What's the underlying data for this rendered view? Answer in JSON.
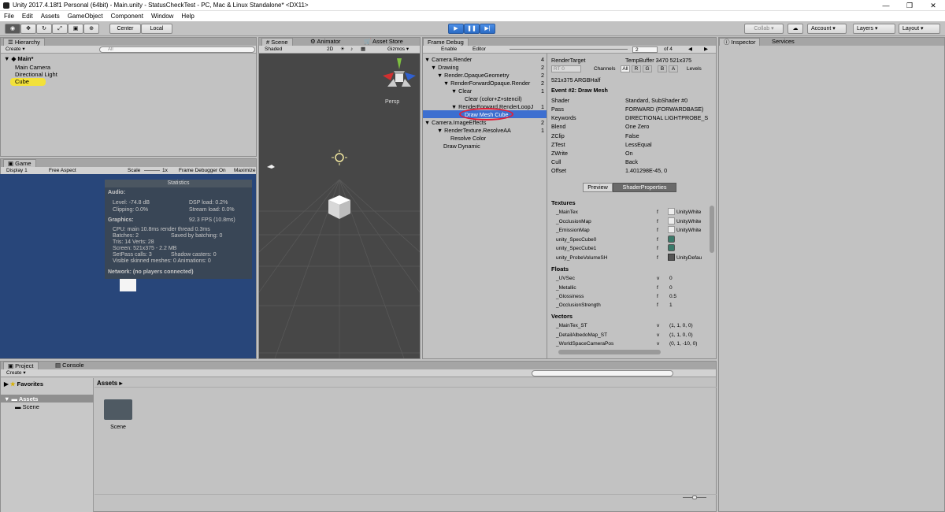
{
  "window": {
    "title": "Unity 2017.4.18f1 Personal (64bit) - Main.unity - StatusCheckTest - PC, Mac & Linux Standalone* <DX11>",
    "minimize": "—",
    "maximize": "❐",
    "close": "✕"
  },
  "menu": [
    "File",
    "Edit",
    "Assets",
    "GameObject",
    "Component",
    "Window",
    "Help"
  ],
  "toolbar": {
    "center": "Center",
    "local": "Local",
    "collab": "Collab ▾",
    "account": "Account",
    "layers": "Layers",
    "layout": "Layout"
  },
  "hierarchy": {
    "tab": "Hierarchy",
    "create": "Create ▾",
    "search_placeholder": "All",
    "scene": "Main*",
    "items": [
      "Main Camera",
      "Directional Light",
      "Cube"
    ]
  },
  "game": {
    "tab": "Game",
    "display": "Display 1",
    "aspect": "Free Aspect",
    "scale_label": "Scale",
    "scale_value": "1x",
    "frame_debugger": "Frame Debugger On",
    "maximize": "Maximize",
    "stats": {
      "title": "Statistics",
      "audio_label": "Audio:",
      "level": "Level: -74.8 dB",
      "dsp": "DSP load: 0.2%",
      "clipping": "Clipping: 0.0%",
      "stream": "Stream load: 0.0%",
      "graphics_label": "Graphics:",
      "fps": "92.3 FPS (10.8ms)",
      "cpu": "CPU: main 10.8ms  render thread 0.3ms",
      "batches": "Batches: 2",
      "saved": "Saved by batching: 0",
      "tris": "Tris: 14   Verts: 28",
      "screen": "Screen: 521x375 - 2.2 MB",
      "setpass": "SetPass calls: 3",
      "shadow": "Shadow casters: 0",
      "skinned": "Visible skinned meshes: 0  Animations: 0",
      "network": "Network: (no players connected)"
    }
  },
  "scene": {
    "tabs": [
      "Scene",
      "Animator",
      "Asset Store"
    ],
    "shaded": "Shaded",
    "mode2d": "2D",
    "gizmos": "Gizmos ▾",
    "persp": "Persp"
  },
  "frame_debug": {
    "tab": "Frame Debug",
    "enable": "Enable",
    "editor": "Editor",
    "event_index": "2",
    "event_total": "of 4",
    "tree": [
      {
        "label": "Camera.Render",
        "count": "4"
      },
      {
        "label": "Drawing",
        "count": "2"
      },
      {
        "label": "Render.OpaqueGeometry",
        "count": "2"
      },
      {
        "label": "RenderForwardOpaque.Render",
        "count": "2"
      },
      {
        "label": "Clear",
        "count": "1"
      },
      {
        "label": "Clear (color+Z+stencil)",
        "count": ""
      },
      {
        "label": "RenderForward.RenderLoopJ",
        "count": "1"
      },
      {
        "label": "Draw Mesh Cube",
        "count": ""
      },
      {
        "label": "Camera.ImageEffects",
        "count": "2"
      },
      {
        "label": "RenderTexture.ResolveAA",
        "count": "1"
      },
      {
        "label": "Resolve Color",
        "count": ""
      },
      {
        "label": "Draw Dynamic",
        "count": ""
      }
    ],
    "render_target_label": "RenderTarget",
    "render_target_value": "TempBuffer 3470 521x375",
    "rt": "RT 0",
    "channels": "Channels",
    "channel_buttons": [
      "All",
      "R",
      "G",
      "B",
      "A"
    ],
    "levels": "Levels",
    "format": "521x375 ARGBHalf",
    "event_title": "Event #2: Draw Mesh",
    "props": [
      {
        "k": "Shader",
        "v": "Standard, SubShader #0"
      },
      {
        "k": "Pass",
        "v": "FORWARD (FORWARDBASE)"
      },
      {
        "k": "Keywords",
        "v": "DIRECTIONAL LIGHTPROBE_S"
      },
      {
        "k": "Blend",
        "v": "One Zero"
      },
      {
        "k": "ZClip",
        "v": "False"
      },
      {
        "k": "ZTest",
        "v": "LessEqual"
      },
      {
        "k": "ZWrite",
        "v": "On"
      },
      {
        "k": "Cull",
        "v": "Back"
      },
      {
        "k": "Offset",
        "v": "1.401298E-45, 0"
      }
    ],
    "preview_tab": "Preview",
    "shaderprops_tab": "ShaderProperties",
    "textures_title": "Textures",
    "textures": [
      {
        "name": "_MainTex",
        "t": "f",
        "v": "UnityWhite"
      },
      {
        "name": "_OcclusionMap",
        "t": "f",
        "v": "UnityWhite"
      },
      {
        "name": "_EmissionMap",
        "t": "f",
        "v": "UnityWhite"
      },
      {
        "name": "unity_SpecCube0",
        "t": "f",
        "v": ""
      },
      {
        "name": "unity_SpecCube1",
        "t": "f",
        "v": ""
      },
      {
        "name": "unity_ProbeVolumeSH",
        "t": "f",
        "v": "UnityDefau"
      }
    ],
    "floats_title": "Floats",
    "floats": [
      {
        "name": "_UVSec",
        "t": "v",
        "v": "0"
      },
      {
        "name": "_Metallic",
        "t": "f",
        "v": "0"
      },
      {
        "name": "_Glossiness",
        "t": "f",
        "v": "0.5"
      },
      {
        "name": "_OcclusionStrength",
        "t": "f",
        "v": "1"
      }
    ],
    "vectors_title": "Vectors",
    "vectors": [
      {
        "name": "_MainTex_ST",
        "t": "v",
        "v": "(1, 1, 0, 0)"
      },
      {
        "name": "_DetailAlbedoMap_ST",
        "t": "v",
        "v": "(1, 1, 0, 0)"
      },
      {
        "name": "_WorldSpaceCameraPos",
        "t": "v",
        "v": "(0, 1, -10, 0)"
      }
    ]
  },
  "inspector": {
    "tabs": [
      "Inspector",
      "Services"
    ]
  },
  "project": {
    "tabs": [
      "Project",
      "Console"
    ],
    "create": "Create ▾",
    "favorites": "Favorites",
    "assets": "Assets",
    "scene_folder": "Scene",
    "breadcrumb": "Assets ▸",
    "asset_items": [
      "Scene"
    ]
  }
}
